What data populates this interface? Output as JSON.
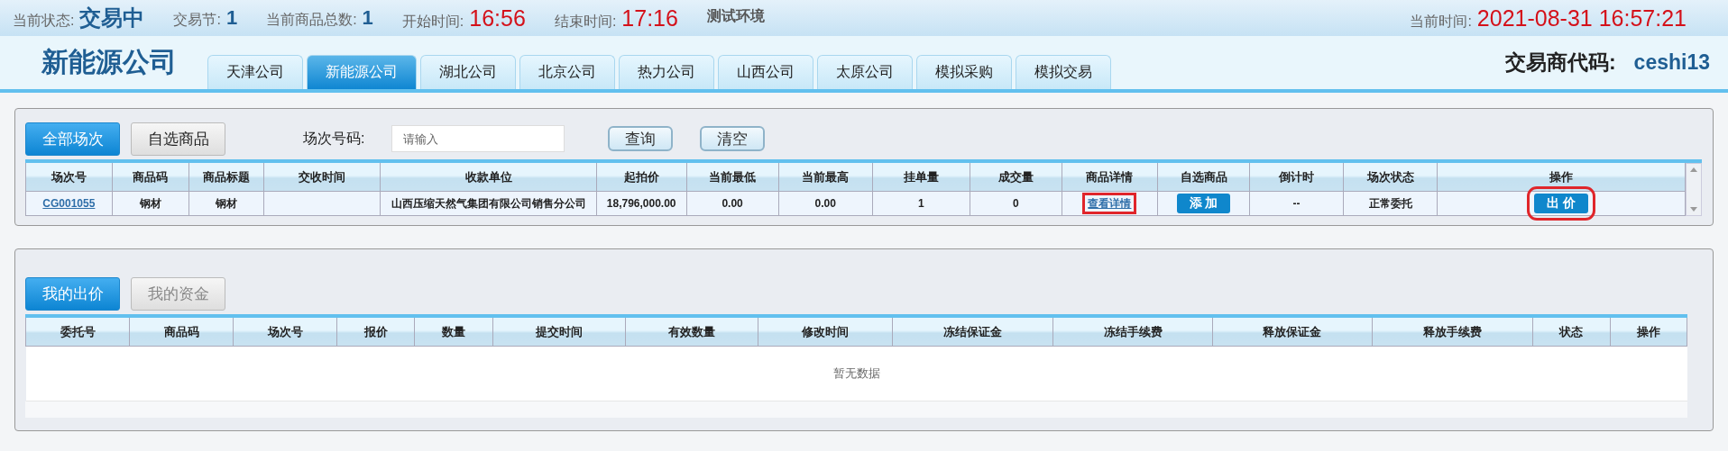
{
  "status_bar": [
    {
      "label": "当前状态:",
      "value": "交易中",
      "kind": "status"
    },
    {
      "label": "交易节:",
      "value": "1",
      "kind": "number"
    },
    {
      "label": "当前商品总数:",
      "value": "1",
      "kind": "number"
    },
    {
      "label": "开始时间:",
      "value": "16:56",
      "kind": "time"
    },
    {
      "label": "结束时间:",
      "value": "17:16",
      "kind": "time"
    }
  ],
  "environment": "测试环境",
  "current_time": {
    "label": "当前时间:",
    "value": "2021-08-31 16:57:21"
  },
  "company": "新能源公司",
  "nav_tabs": [
    {
      "label": "天津公司",
      "selected": false
    },
    {
      "label": "新能源公司",
      "selected": true
    },
    {
      "label": "湖北公司",
      "selected": false
    },
    {
      "label": "北京公司",
      "selected": false
    },
    {
      "label": "热力公司",
      "selected": false
    },
    {
      "label": "山西公司",
      "selected": false
    },
    {
      "label": "太原公司",
      "selected": false
    },
    {
      "label": "模拟采购",
      "selected": false
    },
    {
      "label": "模拟交易",
      "selected": false
    }
  ],
  "trader": {
    "label": "交易商代码:",
    "value": "ceshi13"
  },
  "sessions_panel": {
    "tabs": [
      {
        "label": "全部场次",
        "selected": true
      },
      {
        "label": "自选商品",
        "selected": false
      }
    ],
    "search": {
      "label": "场次号码:",
      "placeholder": "请输入"
    },
    "buttons": [
      "查询",
      "清空"
    ],
    "columns": [
      "场次号",
      "商品码",
      "商品标题",
      "交收时间",
      "收款单位",
      "起拍价",
      "当前最低",
      "当前最高",
      "挂单量",
      "成交量",
      "商品详情",
      "自选商品",
      "倒计时",
      "场次状态",
      "操作"
    ],
    "rows": [
      {
        "cells": [
          {
            "kind": "link",
            "text": "CG001055"
          },
          {
            "kind": "text",
            "text": "钢材"
          },
          {
            "kind": "text",
            "text": "钢材"
          },
          {
            "kind": "text",
            "text": ""
          },
          {
            "kind": "text",
            "text": "山西压缩天然气集团有限公司销售分公司"
          },
          {
            "kind": "text",
            "text": "18,796,000.00"
          },
          {
            "kind": "text",
            "text": "0.00"
          },
          {
            "kind": "text",
            "text": "0.00"
          },
          {
            "kind": "text",
            "text": "1"
          },
          {
            "kind": "text",
            "text": "0"
          },
          {
            "kind": "link",
            "text": "查看详情",
            "highlighted": true
          },
          {
            "kind": "button",
            "text": "添 加"
          },
          {
            "kind": "text",
            "text": "--"
          },
          {
            "kind": "text",
            "text": "正常委托"
          },
          {
            "kind": "button",
            "text": "出 价",
            "highlighted": true
          }
        ]
      }
    ]
  },
  "orders_panel": {
    "tabs": [
      {
        "label": "我的出价",
        "selected": true
      },
      {
        "label": "我的资金",
        "selected": false
      }
    ],
    "columns": [
      "委托号",
      "商品码",
      "场次号",
      "报价",
      "数量",
      "提交时间",
      "有效数量",
      "修改时间",
      "冻结保证金",
      "冻结手续费",
      "释放保证金",
      "释放手续费",
      "状态",
      "操作"
    ],
    "empty_text": "暂无数据"
  }
}
